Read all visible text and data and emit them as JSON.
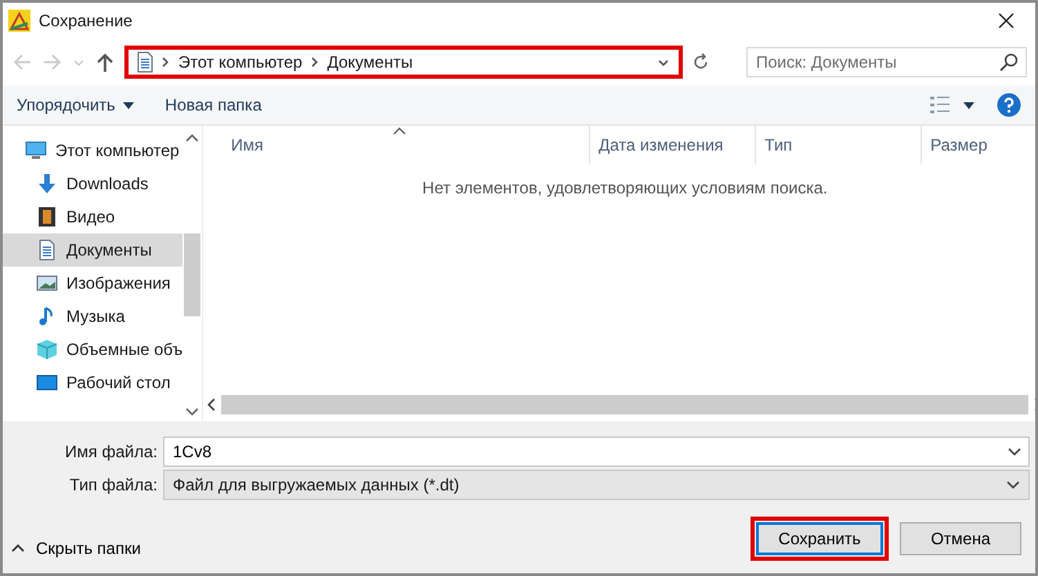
{
  "window": {
    "title": "Сохранение"
  },
  "address": {
    "segments": [
      "Этот компьютер",
      "Документы"
    ],
    "highlighted": true
  },
  "search": {
    "placeholder": "Поиск: Документы"
  },
  "toolbar": {
    "organize": "Упорядочить",
    "new_folder": "Новая папка"
  },
  "sidebar": {
    "items": [
      {
        "label": "Этот компьютер",
        "kind": "computer",
        "selected": false
      },
      {
        "label": "Downloads",
        "kind": "downloads",
        "selected": false
      },
      {
        "label": "Видео",
        "kind": "video",
        "selected": false
      },
      {
        "label": "Документы",
        "kind": "documents",
        "selected": true
      },
      {
        "label": "Изображения",
        "kind": "pictures",
        "selected": false
      },
      {
        "label": "Музыка",
        "kind": "music",
        "selected": false
      },
      {
        "label": "Объемные объ",
        "kind": "objects3d",
        "selected": false
      },
      {
        "label": "Рабочий стол",
        "kind": "desktop",
        "selected": false
      }
    ]
  },
  "table": {
    "columns": [
      "Имя",
      "Дата изменения",
      "Тип",
      "Размер"
    ],
    "empty_message": "Нет элементов, удовлетворяющих условиям поиска."
  },
  "file_name": {
    "label": "Имя файла:",
    "value": "1Cv8"
  },
  "file_type": {
    "label": "Тип файла:",
    "value": "Файл для выгружаемых данных (*.dt)"
  },
  "hide_folders": "Скрыть папки",
  "buttons": [
    {
      "label": "Сохранить",
      "highlighted": true
    },
    {
      "label": "Отмена",
      "highlighted": false
    }
  ]
}
